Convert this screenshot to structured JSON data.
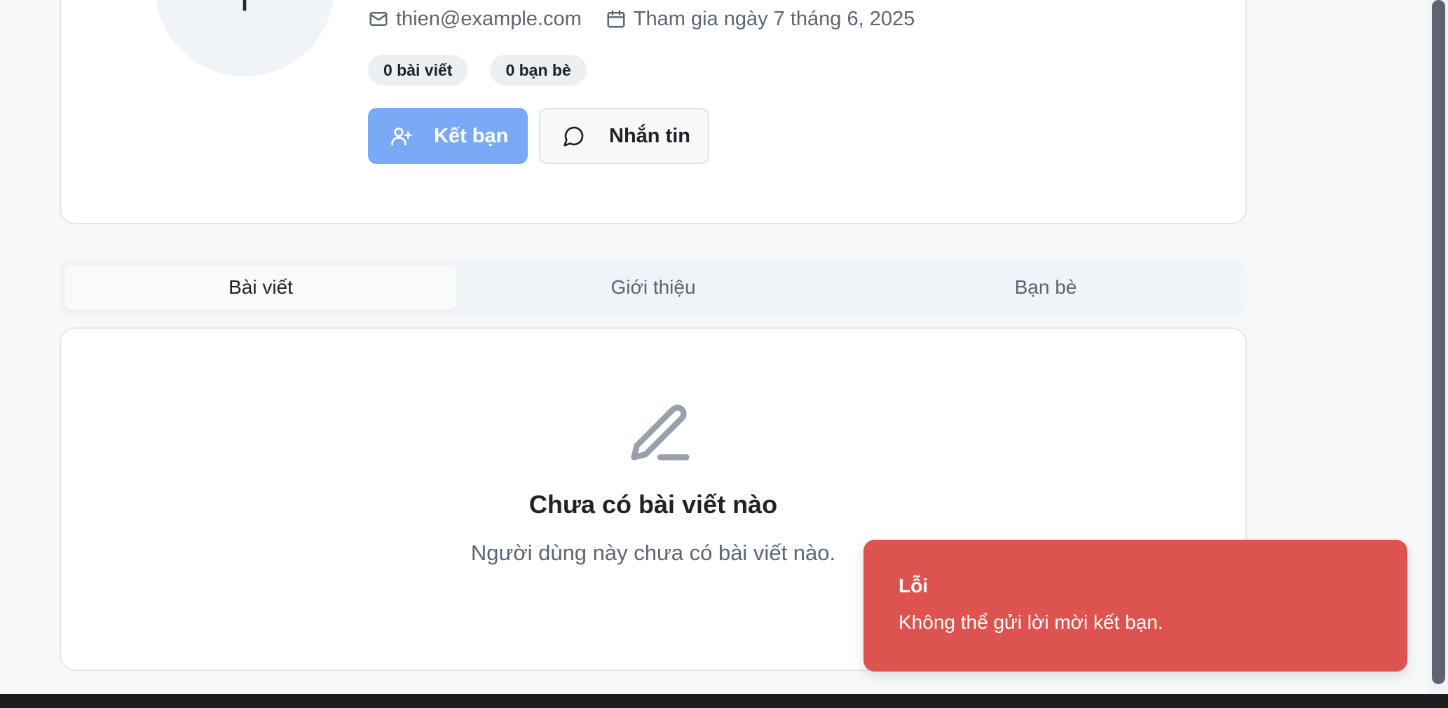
{
  "profile": {
    "avatar_initial": "T",
    "email": "thien@example.com",
    "joined": "Tham gia ngày 7 tháng 6, 2025",
    "stats": {
      "posts": "0 bài viết",
      "friends": "0 bạn bè"
    },
    "actions": {
      "add_friend_label": "Kết bạn",
      "message_label": "Nhắn tin"
    }
  },
  "tabs": [
    {
      "label": "Bài viết",
      "active": true
    },
    {
      "label": "Giới thiệu",
      "active": false
    },
    {
      "label": "Bạn bè",
      "active": false
    }
  ],
  "posts_empty": {
    "icon": "pencil-icon",
    "title": "Chưa có bài viết nào",
    "subtitle": "Người dùng này chưa có bài viết nào."
  },
  "toast": {
    "title": "Lỗi",
    "message": "Không thể gửi lời mời kết bạn.",
    "color": "#dd5350"
  },
  "colors": {
    "primary_button": "#7aa9f6",
    "muted_text": "#5c6572"
  }
}
